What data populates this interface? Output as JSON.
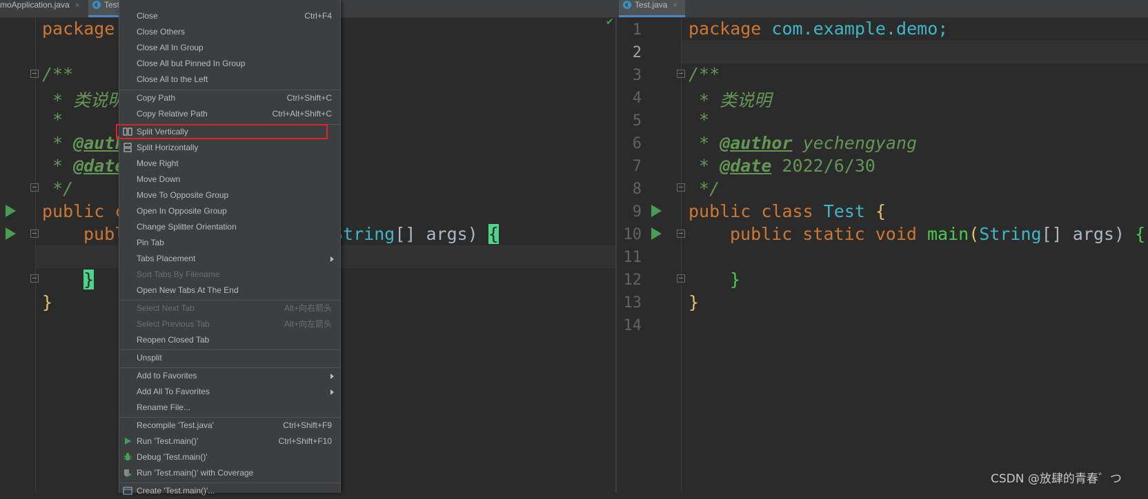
{
  "left_tabs": [
    {
      "label": "moApplication.java",
      "close": "×"
    },
    {
      "label": "Test.java",
      "close": "×"
    }
  ],
  "right_tab": {
    "label": "Test.java",
    "close": "×"
  },
  "left_code": {
    "l1": "package",
    "l3": "/**",
    "l4": " * 类说明",
    "l5": " *",
    "l6_tag": "@author",
    "l7_tag": "@date",
    "l8": " */",
    "l9": "public c",
    "l10a": "publ",
    "l10b": "String",
    "l10c": "[] args) ",
    "l10d": "{",
    "l12": "}",
    "l13": "}"
  },
  "right_code": {
    "pkg_kw": "package",
    "pkg_name": "com.example.demo;",
    "c_open": "/**",
    "c_desc": " * 类说明",
    "c_star": " *",
    "author_tag": "@author",
    "author_val": "yechengyang",
    "date_tag": "@date",
    "date_val": "2022/6/30",
    "c_close": " */",
    "cls_kw": "public class",
    "cls_name": "Test",
    "brace_open": "{",
    "main_kw": "public static void",
    "main_fn": "main",
    "paren": "(",
    "str_type": "String",
    "args": "[] args) ",
    "brace_close": "}"
  },
  "line_numbers": [
    "1",
    "2",
    "3",
    "4",
    "5",
    "6",
    "7",
    "8",
    "9",
    "10",
    "11",
    "12",
    "13",
    "14"
  ],
  "menu": [
    {
      "label": "Close",
      "shortcut": "Ctrl+F4"
    },
    {
      "label": "Close Others",
      "shortcut": ""
    },
    {
      "label": "Close All In Group",
      "shortcut": ""
    },
    {
      "label": "Close All but Pinned In Group",
      "shortcut": ""
    },
    {
      "label": "Close All to the Left",
      "shortcut": ""
    },
    {
      "label": "Copy Path",
      "shortcut": "Ctrl+Shift+C"
    },
    {
      "label": "Copy Relative Path",
      "shortcut": "Ctrl+Alt+Shift+C"
    },
    {
      "label": "Split Vertically",
      "shortcut": "",
      "icon": "split-vertical-icon"
    },
    {
      "label": "Split Horizontally",
      "shortcut": "",
      "icon": "split-horizontal-icon"
    },
    {
      "label": "Move Right",
      "shortcut": ""
    },
    {
      "label": "Move Down",
      "shortcut": ""
    },
    {
      "label": "Move To Opposite Group",
      "shortcut": ""
    },
    {
      "label": "Open In Opposite Group",
      "shortcut": ""
    },
    {
      "label": "Change Splitter Orientation",
      "shortcut": ""
    },
    {
      "label": "Pin Tab",
      "shortcut": ""
    },
    {
      "label": "Tabs Placement",
      "shortcut": ""
    },
    {
      "label": "Sort Tabs By Filename",
      "shortcut": "",
      "disabled": true
    },
    {
      "label": "Open New Tabs At The End",
      "shortcut": ""
    },
    {
      "label": "Select Next Tab",
      "shortcut": "Alt+向右箭头",
      "disabled": true
    },
    {
      "label": "Select Previous Tab",
      "shortcut": "Alt+向左箭头",
      "disabled": true
    },
    {
      "label": "Reopen Closed Tab",
      "shortcut": ""
    },
    {
      "label": "Unsplit",
      "shortcut": ""
    },
    {
      "label": "Add to Favorites",
      "shortcut": ""
    },
    {
      "label": "Add All To Favorites",
      "shortcut": ""
    },
    {
      "label": "Rename File...",
      "shortcut": ""
    },
    {
      "label": "Recompile 'Test.java'",
      "shortcut": "Ctrl+Shift+F9"
    },
    {
      "label": "Run 'Test.main()'",
      "shortcut": "Ctrl+Shift+F10",
      "icon": "run-icon"
    },
    {
      "label": "Debug 'Test.main()'",
      "shortcut": "",
      "icon": "debug-icon"
    },
    {
      "label": "Run 'Test.main()' with Coverage",
      "shortcut": "",
      "icon": "coverage-icon"
    },
    {
      "label": "Create 'Test.main()'...",
      "shortcut": "",
      "icon": "create-config-icon"
    }
  ],
  "highlighted_item": "Split Vertically",
  "colors": {
    "highlight_box": "#e02424",
    "keyword": "#cc7832",
    "comment": "#629755",
    "type": "#3fb6c6"
  },
  "watermark": "CSDN @放肆的青春゛つ"
}
